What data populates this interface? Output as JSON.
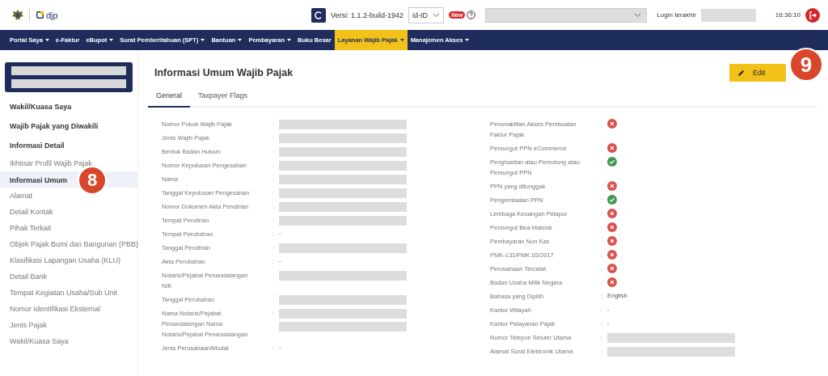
{
  "header": {
    "brand": "djp",
    "version": "Versi: 1.1.2-build-1942",
    "language": "id-ID",
    "new_badge": "New",
    "last_login_label": "Login terakhir",
    "time": "16:36:10"
  },
  "nav": [
    {
      "label": "Portal Saya",
      "caret": true,
      "selected": false
    },
    {
      "label": "e-Faktur",
      "caret": false,
      "selected": false
    },
    {
      "label": "eBupot",
      "caret": true,
      "selected": false
    },
    {
      "label": "Surat Pemberitahuan (SPT)",
      "caret": true,
      "selected": false
    },
    {
      "label": "Bantuan",
      "caret": true,
      "selected": false
    },
    {
      "label": "Pembayaran",
      "caret": true,
      "selected": false
    },
    {
      "label": "Buku Besar",
      "caret": false,
      "selected": false
    },
    {
      "label": "Layanan Wajib Pajak",
      "caret": true,
      "selected": true
    },
    {
      "label": "Manajemen Akses",
      "caret": true,
      "selected": false
    }
  ],
  "sidebar": {
    "items": [
      {
        "label": "Wakil/Kuasa Saya",
        "kind": "group",
        "selected": false
      },
      {
        "label": "Wajib Pajak yang Diwakili",
        "kind": "group",
        "selected": false
      },
      {
        "label": "Informasi Detail",
        "kind": "group",
        "selected": false
      },
      {
        "label": "Ikhtisar Profil Wajib Pajak",
        "kind": "item",
        "selected": false
      },
      {
        "label": "Informasi Umum",
        "kind": "item",
        "selected": true
      },
      {
        "label": "Alamat",
        "kind": "item",
        "selected": false
      },
      {
        "label": "Detail Kontak",
        "kind": "item",
        "selected": false
      },
      {
        "label": "Pihak Terkait",
        "kind": "item",
        "selected": false
      },
      {
        "label": "Objek Pajak Bumi dan Bangunan (PBB)",
        "kind": "item",
        "selected": false
      },
      {
        "label": "Klasifikasi Lapangan Usaha (KLU)",
        "kind": "item",
        "selected": false
      },
      {
        "label": "Detail Bank",
        "kind": "item",
        "selected": false
      },
      {
        "label": "Tempat Kegiatan Usaha/Sub Unit",
        "kind": "item",
        "selected": false
      },
      {
        "label": "Nomor Identifikasi Eksternal",
        "kind": "item",
        "selected": false
      },
      {
        "label": "Jenis Pajak",
        "kind": "item",
        "selected": false
      },
      {
        "label": "Wakil/Kuasa Saya",
        "kind": "item",
        "selected": false
      }
    ],
    "callout": "8"
  },
  "main": {
    "title": "Informasi Umum Wajib Pajak",
    "edit_button": "Edit",
    "callout": "9",
    "tabs": [
      {
        "label": "General",
        "selected": true
      },
      {
        "label": "Taxpayer Flags",
        "selected": false
      }
    ],
    "left_fields": [
      {
        "label": "Nomor Pokok Wajib Pajak",
        "colon": ":",
        "kind": "redacted"
      },
      {
        "label": "Jenis Wajib Pajak",
        "colon": ":",
        "kind": "redacted"
      },
      {
        "label": "Bentuk Badan Hukum",
        "colon": ":",
        "kind": "redacted"
      },
      {
        "label": "Nomor Keputusan Pengesahan",
        "colon": ":",
        "kind": "redacted"
      },
      {
        "label": "Nama",
        "colon": ":",
        "kind": "redacted"
      },
      {
        "label": "Tanggal Keputusan Pengesahan",
        "colon": ":",
        "kind": "redacted"
      },
      {
        "label": "Nomor Dokumen Akta Pendirian",
        "colon": ":",
        "kind": "redacted"
      },
      {
        "label": "Tempat Pendirian",
        "colon": ":",
        "kind": "redacted"
      },
      {
        "label": "Tempat Perubahan",
        "colon": ":",
        "kind": "text",
        "value": "-"
      },
      {
        "label": "Tanggal Pendirian",
        "colon": ":",
        "kind": "redacted"
      },
      {
        "label": "Akta Perubahan",
        "colon": ":",
        "kind": "text",
        "value": "-"
      },
      {
        "label": "Notaris/Pejabat Penandatangan NIK",
        "colon": ":",
        "kind": "redacted"
      },
      {
        "label": "Tanggal Perubahan",
        "colon": ":",
        "kind": "redacted"
      },
      {
        "label": "Nama Notaris/Pejabat Penandatangan Nama Notaris/Pejabat Penandatangan",
        "colon": ":",
        "kind": "double-redacted"
      },
      {
        "label": "Jenis Perusahaan/Modal",
        "colon": ":",
        "kind": "text",
        "value": "-"
      }
    ],
    "right_fields": [
      {
        "label": "Penonaktifan Akses Pembuatan Faktur Pajak",
        "colon": ":",
        "kind": "status",
        "on": false
      },
      {
        "label": "Pemungut PPN eCommerce",
        "colon": ":",
        "kind": "status",
        "on": false
      },
      {
        "label": "Penghasilan atau Pemotong atau Pemungut PPN",
        "colon": ":",
        "kind": "status",
        "on": true
      },
      {
        "label": "PPN yang ditunggak",
        "colon": ":",
        "kind": "status",
        "on": false
      },
      {
        "label": "Pengembalian PPN",
        "colon": ":",
        "kind": "status",
        "on": true
      },
      {
        "label": "Lembaga Keuangan Pelapor",
        "colon": ":",
        "kind": "status",
        "on": false
      },
      {
        "label": "Pemungut Bea Materai",
        "colon": ":",
        "kind": "status",
        "on": false
      },
      {
        "label": "Pembayaran Non Kas",
        "colon": ":",
        "kind": "status",
        "on": false
      },
      {
        "label": "PMK-131/PMK.03/2017",
        "colon": ":",
        "kind": "status",
        "on": false
      },
      {
        "label": "Perusahaan Tercatat",
        "colon": ":",
        "kind": "status",
        "on": false
      },
      {
        "label": "Badan Usaha Milik Negara",
        "colon": ":",
        "kind": "status",
        "on": false
      },
      {
        "label": "Bahasa yang Dipilih",
        "colon": ":",
        "kind": "text",
        "value": "English"
      },
      {
        "label": "Kantor Wilayah",
        "colon": ":",
        "kind": "text",
        "value": "-"
      },
      {
        "label": "Kantor Pelayanan Pajak",
        "colon": ":",
        "kind": "text",
        "value": "-"
      },
      {
        "label": "Nomor Telepon Seluler Utama",
        "colon": ":",
        "kind": "redacted"
      },
      {
        "label": "Alamat Surat Elektronik Utama",
        "colon": ":",
        "kind": "redacted"
      }
    ]
  }
}
